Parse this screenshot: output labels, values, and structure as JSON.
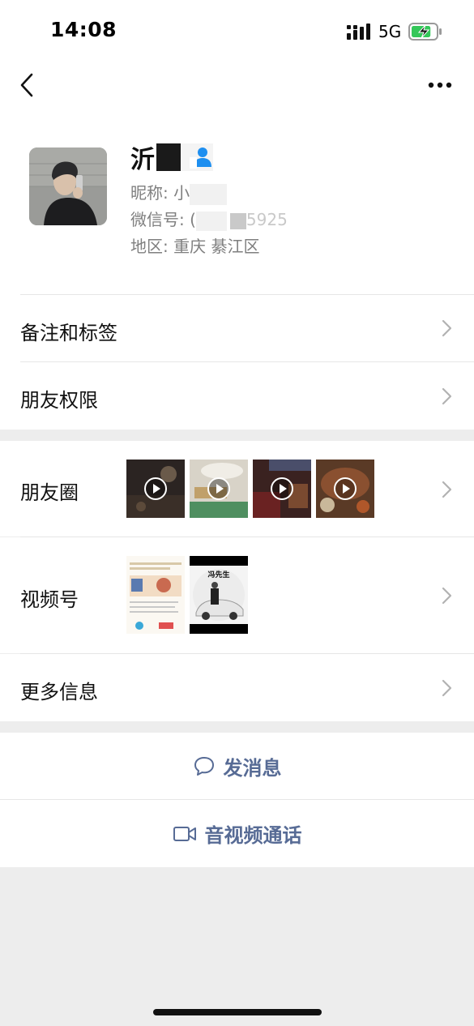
{
  "status_bar": {
    "time": "14:08",
    "network": "5G",
    "battery_level": 0.8,
    "battery_charging": true
  },
  "nav": {
    "back_icon": "chevron-left-icon",
    "more_icon": "ellipsis-icon"
  },
  "profile": {
    "name": "沂",
    "nickname_label": "昵称:",
    "nickname_value": "小",
    "wechat_id_label": "微信号:",
    "wechat_id_value": "(",
    "wechat_id_suffix": "5925",
    "region_label": "地区:",
    "region_value": "重庆  綦江区"
  },
  "menu": {
    "remark_tags": "备注和标签",
    "friend_permissions": "朋友权限",
    "moments": "朋友圈",
    "channels": "视频号",
    "more_info": "更多信息"
  },
  "channels_thumb": {
    "poster_title": "冯先生"
  },
  "actions": {
    "send_message": "发消息",
    "video_call": "音视频通话"
  },
  "colors": {
    "link_blue": "#576b95",
    "page_bg": "#ededed",
    "battery_green": "#34c759"
  }
}
